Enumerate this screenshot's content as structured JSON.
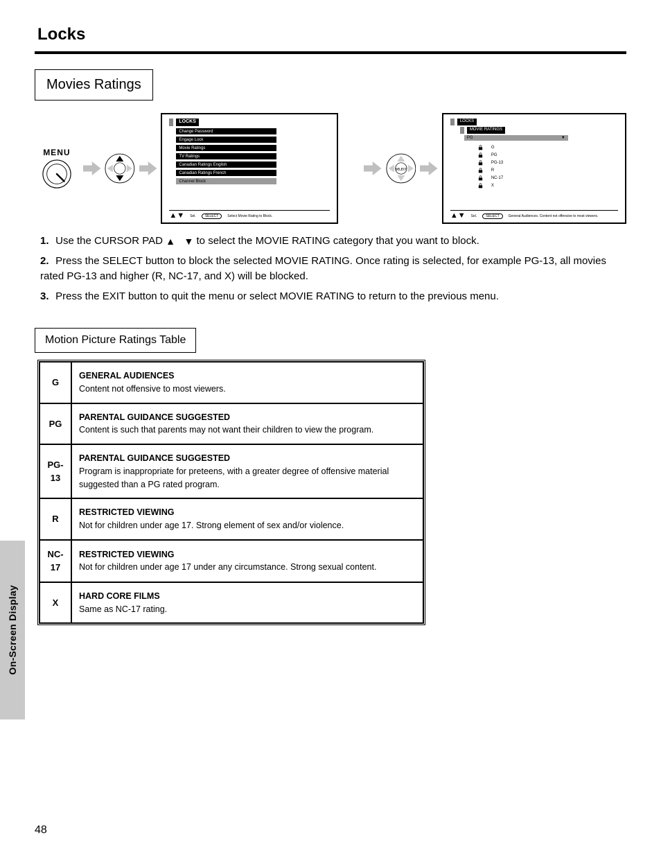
{
  "header": {
    "section": "Locks",
    "title_box": "Movies Ratings"
  },
  "flow": {
    "menu_label": "MENU",
    "osd1": {
      "crumb": "LOCKS",
      "items": [
        "Change Password",
        "Engage Lock",
        "Movie Ratings",
        "TV Ratings",
        "Canadian Ratings English",
        "Canadian Ratings French",
        "Channel Block"
      ],
      "highlight_index": 2,
      "footer_sel": "Sel.",
      "footer_select": "SELECT",
      "footer_tip": "Select Movie Rating to Block."
    },
    "osd2": {
      "crumb1": "LOCKS",
      "crumb2": "MOVIE RATINGS",
      "sub_label": "PG",
      "lock_state": "▼",
      "ratings": [
        "G",
        "PG",
        "PG-13",
        "R",
        "NC-17",
        "X"
      ],
      "footer_sel": "Sel.",
      "footer_select": "SELECT",
      "footer_tip": "General Audiences. Content not offensive to most viewers."
    }
  },
  "steps": {
    "s1_a": "Use the CURSOR PAD",
    "s1_b": "to select the MOVIE RATING category that you want to block.",
    "s2": "Press the SELECT button to block the selected MOVIE RATING. Once rating is selected, for example PG-13, all movies rated PG-13 and higher (R, NC-17, and X) will be blocked.",
    "s3": "Press the EXIT button to quit the menu or select MOVIE RATING to return to the previous menu."
  },
  "table_heading": "Motion Picture Ratings Table",
  "ratings_table": [
    {
      "code": "G",
      "name": "GENERAL AUDIENCES",
      "desc": "Content not offensive to most viewers."
    },
    {
      "code": "PG",
      "name": "PARENTAL GUIDANCE SUGGESTED",
      "desc": "Content is such that parents may not want their children to view the program."
    },
    {
      "code": "PG-13",
      "name": "PARENTAL GUIDANCE SUGGESTED",
      "desc": "Program is inappropriate for preteens, with a greater degree of offensive material suggested than a PG rated program."
    },
    {
      "code": "R",
      "name": "RESTRICTED VIEWING",
      "desc": "Not for children under age 17. Strong element of sex and/or violence."
    },
    {
      "code": "NC-17",
      "name": "RESTRICTED VIEWING",
      "desc": "Not for children under age 17 under any circumstance. Strong sexual content."
    },
    {
      "code": "X",
      "name": "HARD CORE FILMS",
      "desc": "Same as NC-17 rating."
    }
  ],
  "side_tab": "On-Screen Display",
  "page_number": "48"
}
